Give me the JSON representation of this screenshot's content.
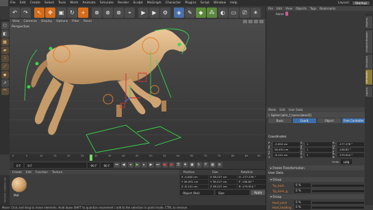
{
  "menubar": {
    "items": [
      "File",
      "Edit",
      "Create",
      "Select",
      "Tools",
      "Mesh",
      "Animate",
      "Simulate",
      "Render",
      "Sculpt",
      "MoGraph",
      "Character",
      "Plugins",
      "Script",
      "Window",
      "Help"
    ],
    "layout_label": "Layout:",
    "layout_value": "Startup"
  },
  "toolbar": {
    "icons": [
      "undo-icon",
      "redo-icon",
      "selection-icon",
      "move-icon",
      "scale-icon",
      "rotate-icon",
      "add-icon",
      "axis-x-icon",
      "axis-y-icon",
      "axis-z-icon",
      "coord-system-icon",
      "render-view-icon",
      "render-picture-icon",
      "render-settings-icon",
      "cube-icon",
      "pen-icon",
      "subdivide-icon",
      "array-icon",
      "deform-icon",
      "floor-icon",
      "camera-icon",
      "light-icon"
    ]
  },
  "viewport": {
    "menu": [
      "View",
      "Cameras",
      "Display",
      "Options",
      "Filter",
      "Panel"
    ],
    "label": "Perspective"
  },
  "timeline": {
    "ticks": [
      "0",
      "5",
      "10",
      "15",
      "20",
      "25",
      "30",
      "35",
      "40",
      "45",
      "50",
      "55",
      "60",
      "65",
      "70",
      "75",
      "80",
      "85",
      "90"
    ],
    "frame_label": "F"
  },
  "transport": {
    "start": "0 F",
    "current": "0 F",
    "end": "90 F",
    "end2": "90 F",
    "play_symbol": "▶",
    "record_symbol": "●"
  },
  "material": {
    "menu": [
      "Create",
      "Edit",
      "Function",
      "Texture"
    ],
    "name": "Mat"
  },
  "coordinates": {
    "headers": [
      "Position",
      "Size",
      "Rotation"
    ],
    "rows": [
      [
        "X  -0.004 cm",
        "X  38.227 cm",
        "H  -177.276 °"
      ],
      [
        "Y  26.491 cm",
        "Y  38.227 cm",
        "P  -158.83 °"
      ],
      [
        "Z  -8.141 cm",
        "Z  38.227 cm",
        "B  -179.914 °"
      ]
    ],
    "mode": "Object (Rel)",
    "size_mode": "Size",
    "apply": "Apply"
  },
  "statusbar": {
    "text": "Move: Click and drag to move elements. Hold down SHIFT to quantize movement / add to the selection in point mode, CTRL to remove."
  },
  "brand": "MAXON CINEMA 4D",
  "objects": {
    "menu": [
      "File",
      "Edit",
      "View",
      "Objects",
      "Tags",
      "Bookmarks"
    ],
    "item": "horse"
  },
  "attributes": {
    "menu": [
      "Mode",
      "Edit",
      "User Data"
    ],
    "title": "Spline [wlm_f_horse.blend1]",
    "tabs": [
      "Basic",
      "Coord.",
      "Object",
      "Free Controller"
    ],
    "section_coords": "Coordinates",
    "rows": [
      [
        "P . X",
        "-0.004 cm",
        "S . X",
        "1",
        "R . H",
        "-177.276 °"
      ],
      [
        "P . Y",
        "26.491 cm",
        "S . Y",
        "1",
        "R . P",
        "-158.83 °"
      ],
      [
        "P . Z",
        "-8.141 cm",
        "S . Z",
        "1",
        "R . B",
        "-179.914 °"
      ]
    ],
    "order_label": "Order",
    "order_value": "HPB",
    "fold_freeze": "▸ Freeze Transformation",
    "section_user": "User Data",
    "fold_group": "▾ Group",
    "props": [
      {
        "name": "Tip_back",
        "value": "0 %"
      },
      {
        "name": "Tip_back_g",
        "value": "0 %"
      }
    ],
    "fold_group2": "▾ Group",
    "props2": [
      {
        "name": "Hoof_pitch",
        "value": "0 %"
      },
      {
        "name": "Hoof_heading",
        "value": "0 %"
      }
    ]
  },
  "side_tabs": [
    "Objects",
    "Content Browser",
    "Structure",
    "Attributes",
    "Layers"
  ]
}
